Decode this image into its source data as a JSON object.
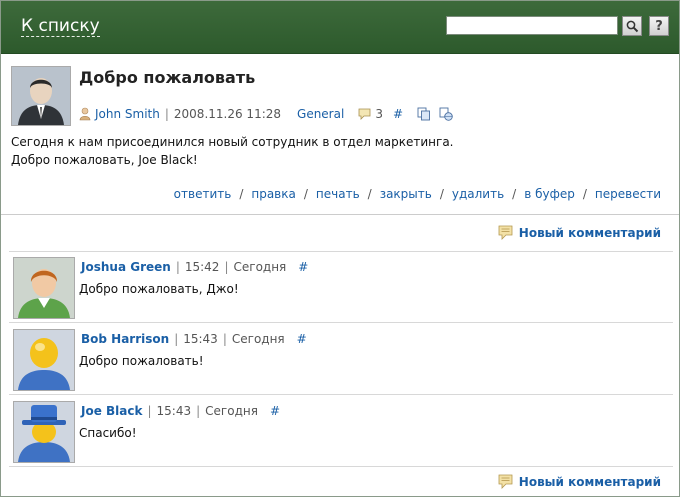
{
  "header": {
    "back_label": "К списку",
    "search_placeholder": "",
    "help_label": "?"
  },
  "post": {
    "title": "Добро пожаловать",
    "author": "John Smith",
    "datetime": "2008.11.26 11:28",
    "category": "General",
    "comment_count": "3",
    "permalink": "#",
    "body_line1": "Сегодня к нам присоединился новый сотрудник в отдел маркетинга.",
    "body_line2": "Добро пожаловать, Joe Black!",
    "actions": [
      "ответить",
      "правка",
      "печать",
      "закрыть",
      "удалить",
      "в буфер",
      "перевести"
    ]
  },
  "new_comment_label": "Новый комментарий",
  "comments": [
    {
      "author": "Joshua Green",
      "time": "15:42",
      "day": "Сегодня",
      "permalink": "#",
      "text": "Добро пожаловать, Джо!"
    },
    {
      "author": "Bob Harrison",
      "time": "15:43",
      "day": "Сегодня",
      "permalink": "#",
      "text": "Добро пожаловать!"
    },
    {
      "author": "Joe Black",
      "time": "15:43",
      "day": "Сегодня",
      "permalink": "#",
      "text": "Спасибо!"
    }
  ],
  "colors": {
    "header_green": "#2d5a2c",
    "link_blue": "#1a5fa6"
  }
}
